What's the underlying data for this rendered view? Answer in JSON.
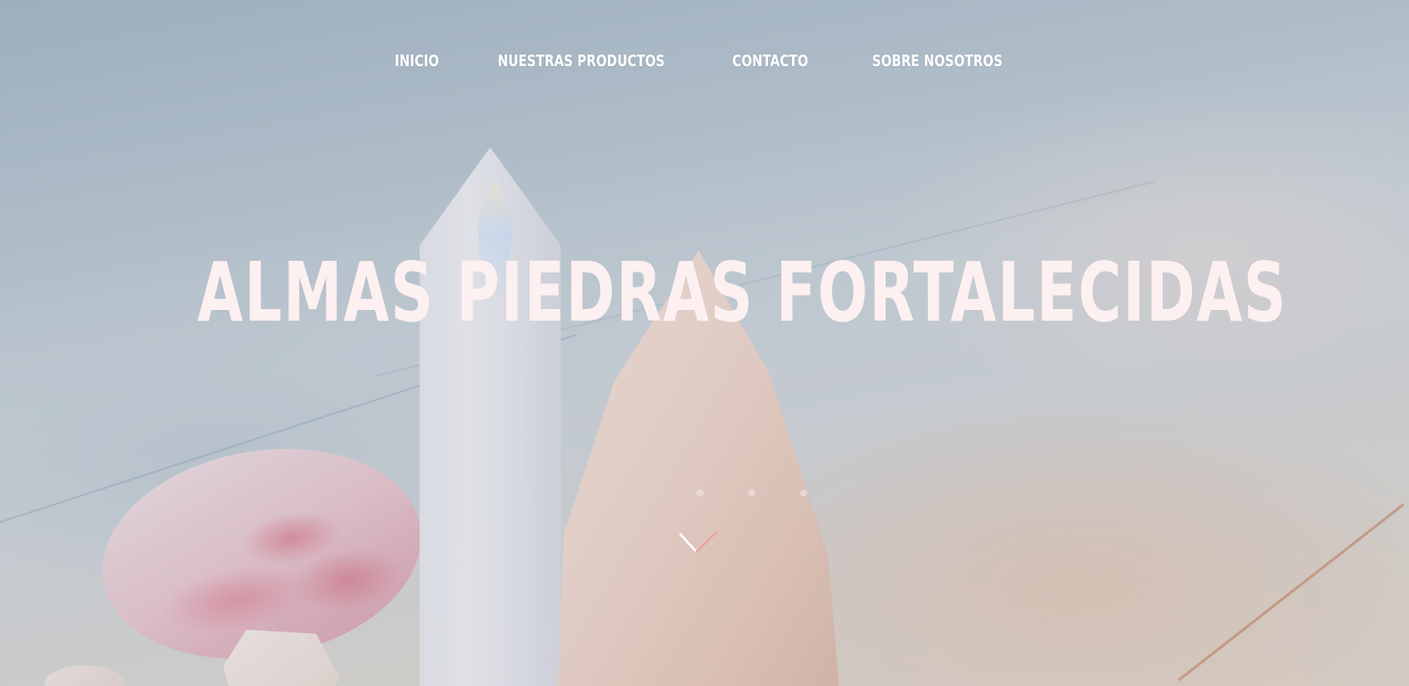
{
  "nav": {
    "items": [
      {
        "label": "INICIO"
      },
      {
        "label": "NUESTRAS PRODUCTOS"
      },
      {
        "label": "CONTACTO"
      },
      {
        "label": "SOBRE NOSOTROS"
      }
    ]
  },
  "hero": {
    "title": "ALMAS PIEDRAS FORTALECIDAS",
    "title_color": "#fdf0f0",
    "scroll_icon": "chevron-down-icon",
    "scroll_colors": [
      "#ffffff",
      "#f0a0a8"
    ],
    "slide_dots": 3
  },
  "background": {
    "image": "marble surface with crystal tower, rose quartz and pink stone"
  }
}
